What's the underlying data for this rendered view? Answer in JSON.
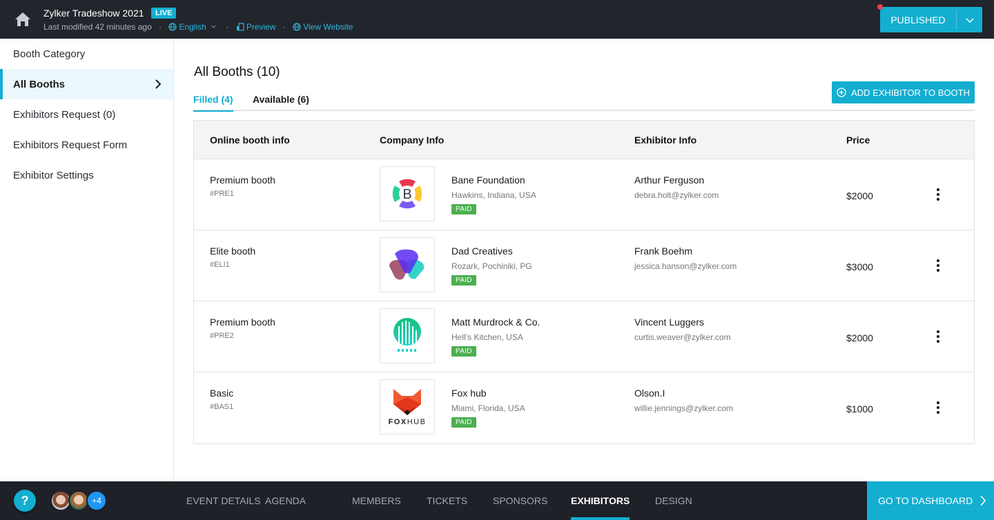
{
  "header": {
    "event_title": "Zylker Tradeshow 2021",
    "live_badge": "LIVE",
    "last_modified": "Last modified 42 minutes ago",
    "language": "English",
    "preview": "Preview",
    "view_website": "View Website",
    "published_label": "PUBLISHED",
    "accent_color": "#13aed0"
  },
  "sidebar": {
    "items": [
      {
        "label": "Booth Category"
      },
      {
        "label": "All Booths",
        "active": true
      },
      {
        "label": "Exhibitors Request (0)"
      },
      {
        "label": "Exhibitors Request Form"
      },
      {
        "label": "Exhibitor Settings"
      }
    ]
  },
  "main": {
    "title": "All Booths (10)",
    "tabs": [
      {
        "label": "Filled (4)",
        "active": true
      },
      {
        "label": "Available (6)"
      }
    ],
    "add_button": "ADD EXHIBITOR TO BOOTH",
    "columns": [
      "Online booth info",
      "Company Info",
      "Exhibitor Info",
      "Price"
    ],
    "rows": [
      {
        "booth": "Premium booth",
        "code": "#PRE1",
        "company": "Bane Foundation",
        "location": "Hawkins, Indiana, USA",
        "status": "PAID",
        "logo": "bane-foundation-logo",
        "exhibitor": "Arthur Ferguson",
        "email": "debra.holt@zylker.com",
        "price": "$2000"
      },
      {
        "booth": "Elite booth",
        "code": "#ELI1",
        "company": "Dad Creatives",
        "location": "Rozark, Pochiniki, PG",
        "status": "PAID",
        "logo": "dad-creatives-logo",
        "exhibitor": "Frank Boehm",
        "email": "jessica.hanson@zylker.com",
        "price": "$3000"
      },
      {
        "booth": "Premium booth",
        "code": "#PRE2",
        "company": "Matt Murdrock & Co.",
        "location": "Hell’s Kitchen, USA",
        "status": "PAID",
        "logo": "matt-murdrock-logo",
        "exhibitor": "Vincent Luggers",
        "email": "curtis.weaver@zylker.com",
        "price": "$2000"
      },
      {
        "booth": "Basic",
        "code": "#BAS1",
        "company": "Fox hub",
        "location": "Miami, Florida, USA",
        "status": "PAID",
        "logo": "fox-hub-logo",
        "logo_text_bold": "FOX",
        "logo_text_light": "HUB",
        "exhibitor": "Olson.I",
        "email": "willie.jennings@zylker.com",
        "price": "$1000"
      }
    ]
  },
  "bottom": {
    "help": "?",
    "more_members": "+4",
    "nav": [
      {
        "label": "EVENT DETAILS"
      },
      {
        "label": "AGENDA"
      },
      {
        "label": "MEMBERS"
      },
      {
        "label": "TICKETS"
      },
      {
        "label": "SPONSORS"
      },
      {
        "label": "EXHIBITORS",
        "active": true
      },
      {
        "label": "DESIGN"
      }
    ],
    "dashboard": "GO TO DASHBOARD"
  }
}
